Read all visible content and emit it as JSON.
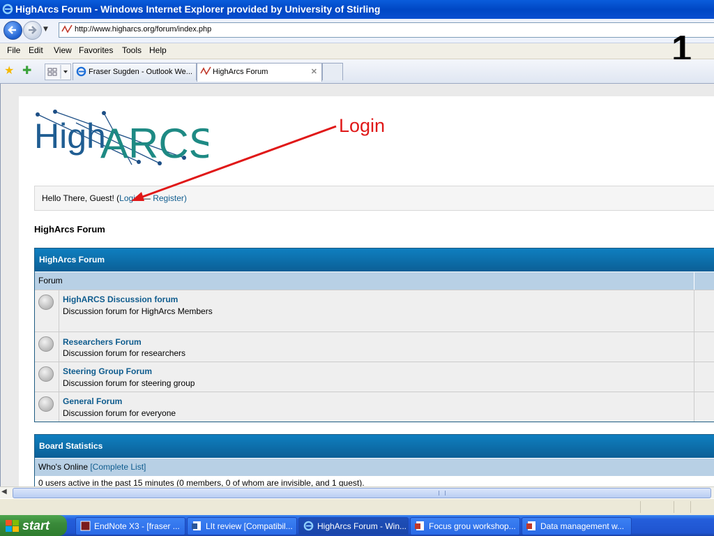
{
  "window": {
    "title": "HighArcs Forum - Windows Internet Explorer provided by University of Stirling"
  },
  "address": {
    "url": "http://www.higharcs.org/forum/index.php"
  },
  "menu": [
    "File",
    "Edit",
    "View",
    "Favorites",
    "Tools",
    "Help"
  ],
  "step_number": "1",
  "tabs": [
    {
      "label": "Fraser Sugden - Outlook We...",
      "active": false
    },
    {
      "label": "HighArcs Forum",
      "active": true
    }
  ],
  "page": {
    "logo_text": "HighARCS",
    "welcome": {
      "greeting": "Hello There, Guest! (",
      "login": "Login",
      "sep": " — ",
      "register": "Register",
      "close": ")"
    },
    "forum_title": "HighArcs Forum",
    "forum_table": {
      "header": "HighArcs Forum",
      "column": "Forum",
      "forums": [
        {
          "name": "HighARCS Discussion forum",
          "desc": "Discussion forum for HighArcs Members"
        },
        {
          "name": "Researchers Forum",
          "desc": "Discussion forum for researchers"
        },
        {
          "name": "Steering Group Forum",
          "desc": "Discussion forum for steering group"
        },
        {
          "name": "General Forum",
          "desc": "Discussion forum for everyone"
        }
      ]
    },
    "stats": {
      "header": "Board Statistics",
      "whos_online": "Who's Online",
      "complete_list": "[Complete List]",
      "active_text": "0 users active in the past 15 minutes (0 members, 0 of whom are invisible, and 1 guest)."
    }
  },
  "annotation": {
    "label": "Login",
    "color": "#e01818"
  },
  "taskbar": {
    "start": "start",
    "tasks": [
      {
        "label": "EndNote X3 - [fraser ...",
        "active": false
      },
      {
        "label": "LIt review [Compatibil...",
        "active": false
      },
      {
        "label": "HighArcs Forum - Win...",
        "active": true
      },
      {
        "label": "Focus grou workshop...",
        "active": false
      },
      {
        "label": "Data management w...",
        "active": false
      }
    ]
  }
}
